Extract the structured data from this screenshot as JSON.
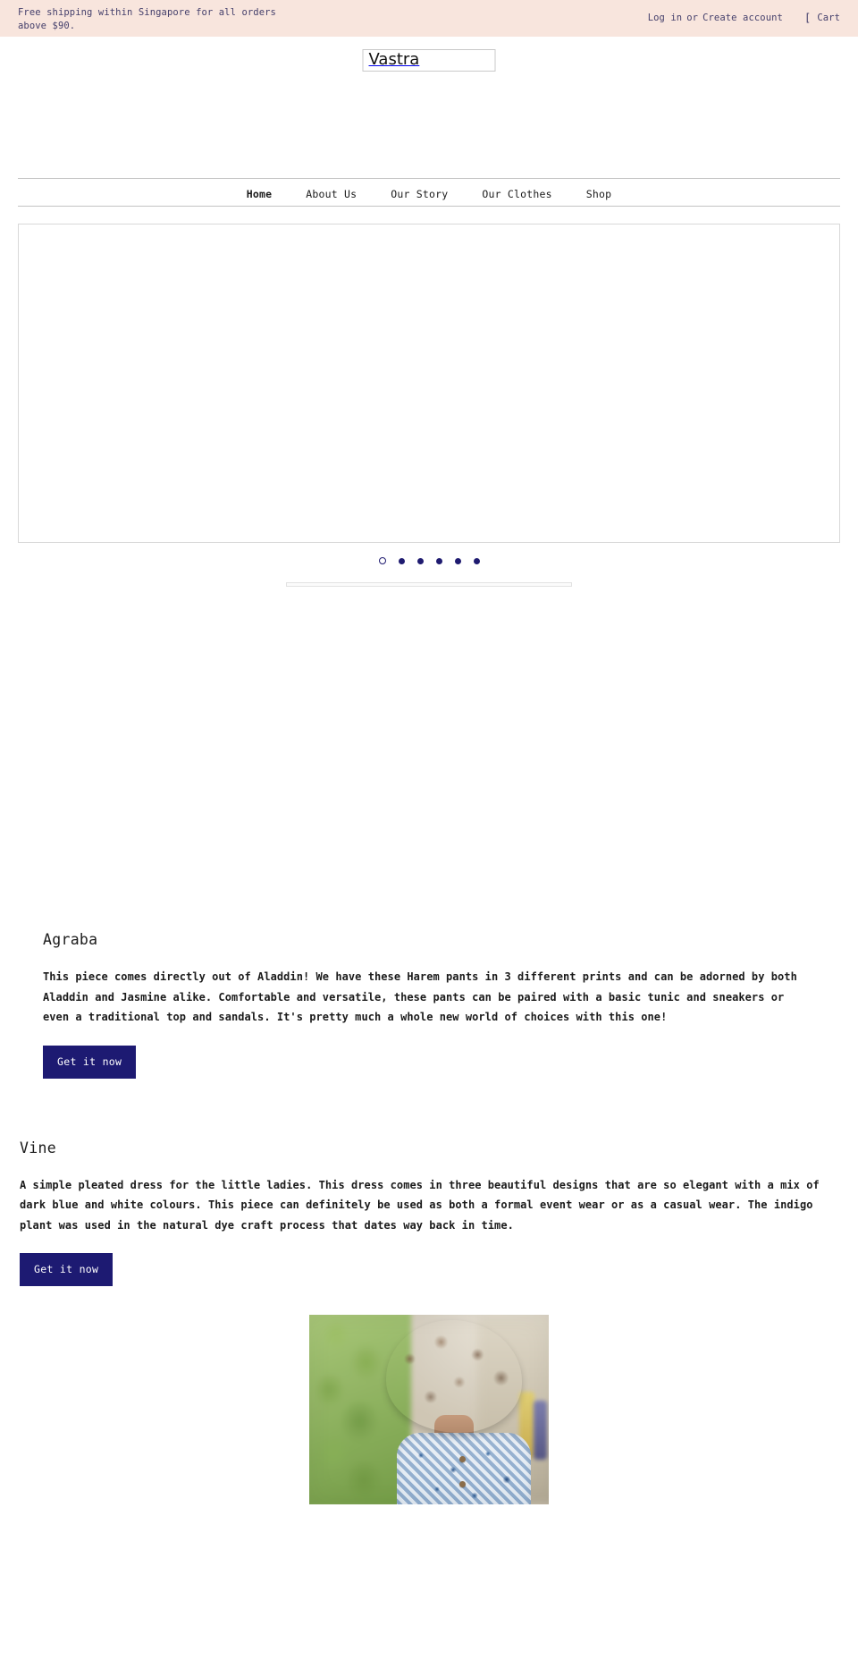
{
  "announcement": {
    "text": "Free shipping within Singapore for all orders above $90.",
    "login_label": "Log in",
    "separator": "or",
    "create_account_label": "Create account",
    "cart_label": "Cart",
    "cart_icon_glyph": "[",
    "cart_icon_name": "cart-icon",
    "background_color": "#f8e5dd",
    "text_color": "#443f6b"
  },
  "header": {
    "logo_alt_text": "Vastra"
  },
  "nav": {
    "items": [
      {
        "label": "Home",
        "active": true
      },
      {
        "label": "About Us",
        "active": false
      },
      {
        "label": "Our Story",
        "active": false
      },
      {
        "label": "Our Clothes",
        "active": false
      },
      {
        "label": "Shop",
        "active": false
      }
    ]
  },
  "slideshow": {
    "slide_count": 6,
    "active_index": 0,
    "dot_color": "#1f1b70"
  },
  "features": [
    {
      "title": "Agraba",
      "body": "This piece comes directly out of Aladdin! We have these Harem pants in 3 different prints and can be adorned by both Aladdin and Jasmine alike. Comfortable and versatile, these pants can be paired with a basic tunic and sneakers or even a traditional top and sandals. It's pretty much a whole new world of choices with this one!",
      "button_label": "Get it now",
      "button_color": "#1d1a72"
    },
    {
      "title": "Vine",
      "body": "A simple pleated dress for the little ladies. This dress comes in three beautiful designs that are so elegant with a mix of dark blue and white colours. This piece can definitely be used as both a formal event wear or as a casual wear. The indigo plant was used in the natural dye craft process that dates way back in time.",
      "button_label": "Get it now",
      "button_color": "#1d1a72"
    }
  ],
  "bottom_photo": {
    "description": "Child with curly dark hair seen from behind wearing a blue and white patterned sleeveless dress with greenery in the background"
  }
}
